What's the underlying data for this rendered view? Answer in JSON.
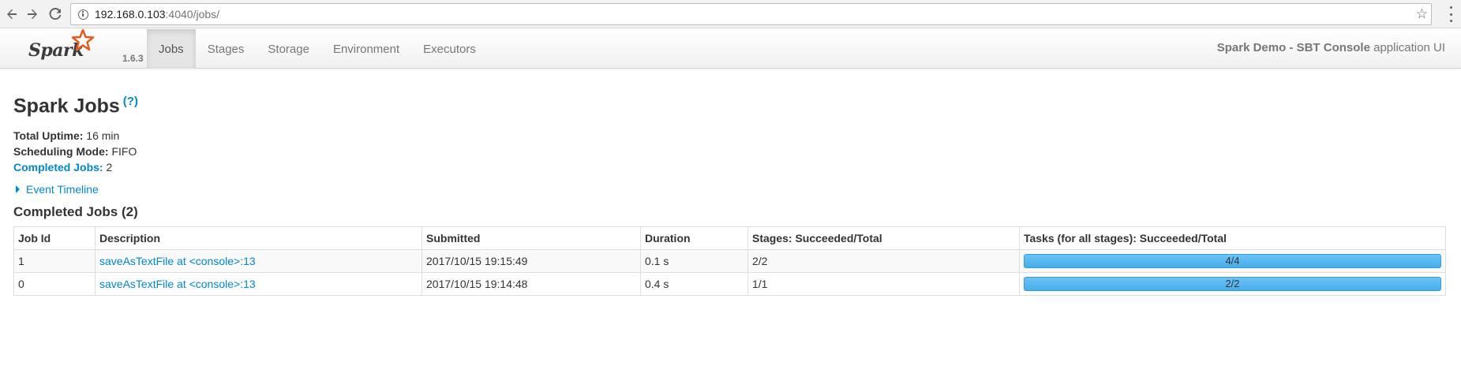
{
  "browser": {
    "url_host": "192.168.0.103",
    "url_rest": ":4040/jobs/"
  },
  "navbar": {
    "brand_name": "Spark",
    "version": "1.6.3",
    "tabs": [
      {
        "label": "Jobs",
        "active": true
      },
      {
        "label": "Stages",
        "active": false
      },
      {
        "label": "Storage",
        "active": false
      },
      {
        "label": "Environment",
        "active": false
      },
      {
        "label": "Executors",
        "active": false
      }
    ],
    "app_name_bold": "Spark Demo - SBT Console",
    "app_name_suffix": " application UI"
  },
  "page": {
    "title": "Spark Jobs",
    "help": "(?)",
    "summary": {
      "uptime_label": "Total Uptime:",
      "uptime_value": " 16 min",
      "mode_label": "Scheduling Mode:",
      "mode_value": " FIFO",
      "completed_label": "Completed Jobs:",
      "completed_value": " 2"
    },
    "event_timeline": "Event Timeline",
    "completed_section_title": "Completed Jobs (2)"
  },
  "table": {
    "headers": [
      "Job Id",
      "Description",
      "Submitted",
      "Duration",
      "Stages: Succeeded/Total",
      "Tasks (for all stages): Succeeded/Total"
    ],
    "rows": [
      {
        "job_id": "1",
        "description": "saveAsTextFile at <console>:13",
        "submitted": "2017/10/15 19:15:49",
        "duration": "0.1 s",
        "stages": "2/2",
        "tasks": "4/4",
        "tasks_progress": 1.0
      },
      {
        "job_id": "0",
        "description": "saveAsTextFile at <console>:13",
        "submitted": "2017/10/15 19:14:48",
        "duration": "0.4 s",
        "stages": "1/1",
        "tasks": "2/2",
        "tasks_progress": 1.0
      }
    ]
  },
  "colors": {
    "link": "#0088cc",
    "progress": "#46aeea",
    "brand_star": "#e25a1c"
  }
}
